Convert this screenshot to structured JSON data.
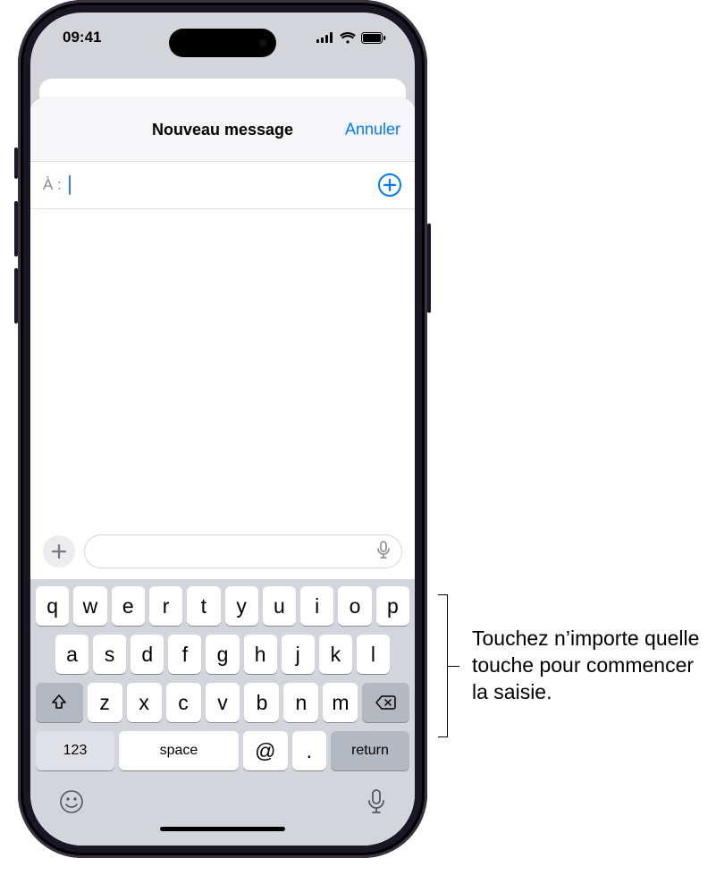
{
  "status": {
    "time": "09:41"
  },
  "sheet": {
    "title": "Nouveau message",
    "cancel": "Annuler",
    "to_label": "À :"
  },
  "keyboard": {
    "row1": [
      "q",
      "w",
      "e",
      "r",
      "t",
      "y",
      "u",
      "i",
      "o",
      "p"
    ],
    "row2": [
      "a",
      "s",
      "d",
      "f",
      "g",
      "h",
      "j",
      "k",
      "l"
    ],
    "row3": [
      "z",
      "x",
      "c",
      "v",
      "b",
      "n",
      "m"
    ],
    "numbers_label": "123",
    "space_label": "space",
    "at_label": "@",
    "dot_label": ".",
    "return_label": "return"
  },
  "callout": {
    "text": "Touchez n’importe quelle touche pour commencer la saisie."
  }
}
